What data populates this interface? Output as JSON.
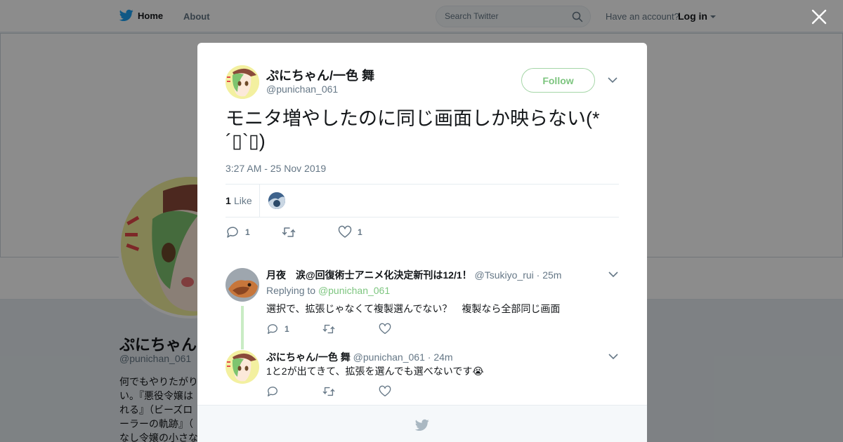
{
  "nav": {
    "home_label": "Home",
    "about_label": "About",
    "search_placeholder": "Search Twitter",
    "account_prompt": "Have an account?",
    "login_label": "Log in"
  },
  "profile": {
    "name": "ぷにちゃん",
    "handle": "@punichan_061",
    "bio": "何でもやりたがり い。『悪役令嬢は れる』（ビーズロ ーラーの軌跡』（ なし令嬢の小さな"
  },
  "tweet": {
    "author_name": "ぷにちゃん/一色 舞",
    "author_handle": "@punichan_061",
    "follow_label": "Follow",
    "text": "モニタ増やしたのに同じ画面しか映らない(*´▯`▯)",
    "timestamp": "3:27 AM - 25 Nov 2019",
    "likes_count": "1",
    "likes_label": "Like",
    "reply_count": "1",
    "like_count": "1"
  },
  "replies": [
    {
      "name": "月夜　涙@回復術士アニメ化決定新刊は12/1！",
      "handle": "@Tsukiyo_rui",
      "time": "25m",
      "replying_prefix": "Replying to",
      "replying_to": "@punichan_061",
      "text": "選択で、拡張じゃなくて複製選んでない？　複製なら全部同じ画面",
      "reply_count": "1"
    },
    {
      "name": "ぷにちゃん/一色 舞",
      "handle": "@punichan_061",
      "time": "24m",
      "text": "1と2が出てきて、拡張を選んでも選べないです😭"
    }
  ],
  "colors": {
    "accent_green": "#7dc57f",
    "twitter_blue": "#1da1f2",
    "muted_text": "#657786"
  }
}
